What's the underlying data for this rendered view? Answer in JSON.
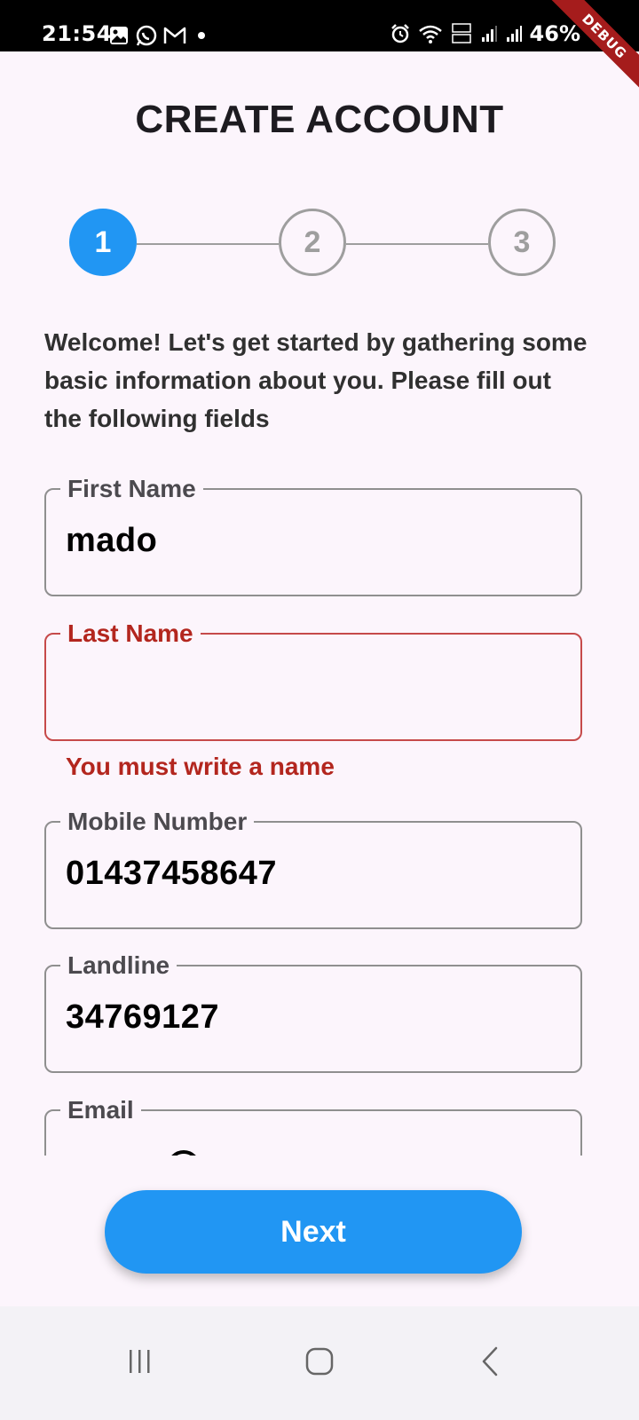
{
  "status_bar": {
    "time": "21:54",
    "battery": "46%",
    "left_icons": [
      "gallery-icon",
      "whatsapp-icon",
      "gmail-icon",
      "dot-icon"
    ],
    "right_icons": [
      "alarm-icon",
      "wifi-icon",
      "volte-icon",
      "signal-icon",
      "signal-icon"
    ]
  },
  "debug_banner": "DEBUG",
  "header": {
    "title": "CREATE ACCOUNT"
  },
  "stepper": {
    "steps": [
      "1",
      "2",
      "3"
    ],
    "active_step": 1,
    "active_color": "#2196f3",
    "inactive_color": "#9e9e9e"
  },
  "intro_text": "Welcome! Let's get started by gathering some basic information about you. Please fill out the following fields",
  "form": {
    "first_name": {
      "label": "First Name",
      "value": "mado"
    },
    "last_name": {
      "label": "Last Name",
      "value": "",
      "error": "You must write a name"
    },
    "mobile": {
      "label": "Mobile Number",
      "value": "01437458647"
    },
    "landline": {
      "label": "Landline",
      "value": "34769127"
    },
    "email": {
      "label": "Email",
      "value": ""
    }
  },
  "actions": {
    "next_label": "Next"
  },
  "colors": {
    "accent": "#2196f3",
    "error": "#b3261e",
    "background": "#fcf5fc"
  },
  "nav_bar": {
    "buttons": [
      "recents-icon",
      "home-icon",
      "back-icon"
    ]
  }
}
